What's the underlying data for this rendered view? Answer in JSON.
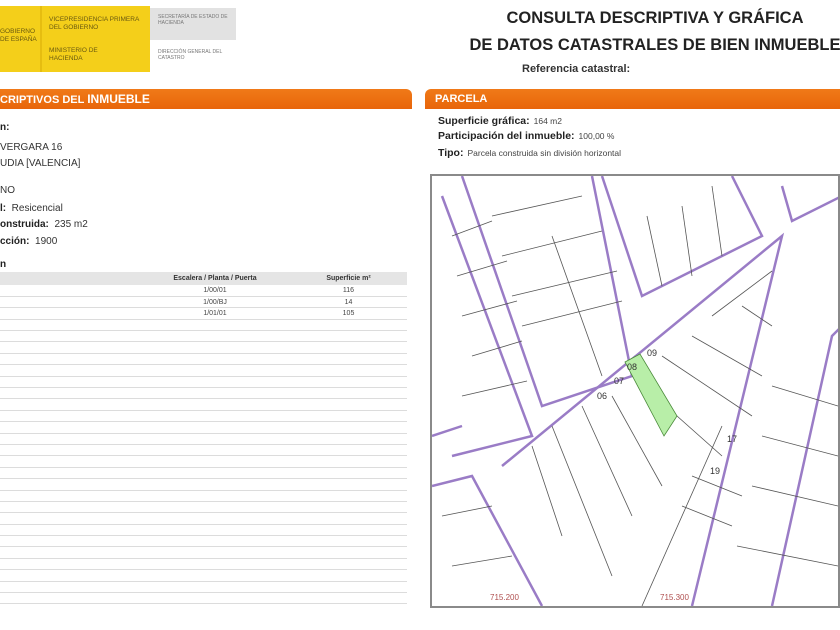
{
  "header": {
    "logo_gov": "GOBIERNO DE ESPAÑA",
    "logo_vice": "VICEPRESIDENCIA PRIMERA DEL GOBIERNO",
    "logo_min": "MINISTERIO DE HACIENDA",
    "logo_sec": "SECRETARÍA DE ESTADO DE HACIENDA",
    "logo_dir": "DIRECCIÓN GENERAL DEL CATASTRO",
    "title_line1": "CONSULTA DESCRIPTIVA Y GRÁFICA",
    "title_line2": "DE DATOS CATASTRALES DE BIEN INMUEBLE",
    "reference_label": "Referencia catastral:"
  },
  "left": {
    "section_title_pre": "CRIPTIVOS DEL ",
    "section_title_bold": "INMUEBLE",
    "location_label": "n:",
    "address_line1": "VERGARA 16",
    "address_line2": "UDIA [VALENCIA]",
    "class_value": "NO",
    "use_label": "l:",
    "use_value": "Resicencial",
    "built_label": "onstruida:",
    "built_value": "235 m2",
    "year_label": "cción:",
    "year_value": "1900",
    "construction_label": "n",
    "table": {
      "headers": [
        "Escalera / Planta / Puerta",
        "Superficie m²"
      ],
      "rows": [
        [
          "1/00/01",
          "116"
        ],
        [
          "1/00/BJ",
          "14"
        ],
        [
          "1/01/01",
          "105"
        ]
      ]
    }
  },
  "parcela": {
    "section_title": "PARCELA",
    "superficie_label": "Superficie gráfica:",
    "superficie_value": "164 m2",
    "participacion_label": "Participación del inmueble:",
    "participacion_value": "100,00 %",
    "tipo_label": "Tipo:",
    "tipo_value": "Parcela construida sin división horizontal"
  },
  "map": {
    "parcel_labels": [
      "06",
      "07",
      "08",
      "09",
      "17",
      "19"
    ],
    "coord_labels": [
      "715.200",
      "715.300"
    ],
    "highlight_color": "#b8eea8",
    "street_color": "#9a7cc6"
  }
}
